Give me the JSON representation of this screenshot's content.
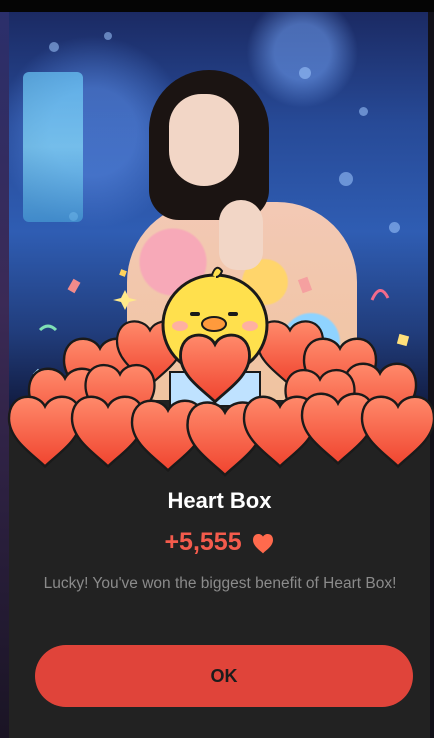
{
  "dialog": {
    "title": "Heart Box",
    "reward_amount": "+5,555",
    "reward_icon": "heart-icon",
    "message": "Lucky! You've won the biggest benefit of Heart Box!",
    "ok_label": "OK"
  },
  "colors": {
    "accent": "#e0443a",
    "reward_text": "#f45b4c",
    "dialog_bg": "#222222",
    "heart": "#ff5c45"
  }
}
